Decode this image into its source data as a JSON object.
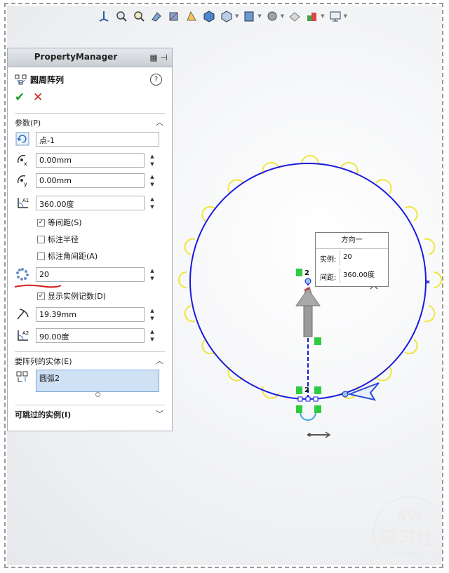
{
  "property_manager": {
    "title": "PropertyManager",
    "feature_name": "圆周阵列",
    "help_label": "?",
    "ok_glyph": "✔",
    "cancel_glyph": "✕",
    "params": {
      "header": "参数(P)",
      "center_point": "点-1",
      "center_x": "0.00mm",
      "center_y": "0.00mm",
      "angle": "360.00度",
      "equal_spacing_label": "等间距(S)",
      "equal_spacing_checked": true,
      "dim_radius_label": "标注半径",
      "dim_radius_checked": false,
      "dim_angle_label": "标注角间距(A)",
      "dim_angle_checked": false,
      "instances": "20",
      "show_count_label": "显示实例记数(D)",
      "show_count_checked": true,
      "radius": "19.39mm",
      "arc_angle": "90.00度"
    },
    "entities": {
      "header": "要阵列的实体(E)",
      "selected": "圆弧2"
    },
    "skip": {
      "header": "可跳过的实例(I)"
    }
  },
  "direction_popup": {
    "title": "方向一",
    "instances_label": "实例:",
    "instances_value": "20",
    "spacing_label": "间距:",
    "spacing_value": "360.00度"
  },
  "sketch": {
    "relation_label": "2",
    "circle_color": "#1a1adc",
    "pattern_arc_color": "#f0e63c",
    "relation_color": "#2ecc40"
  },
  "watermark": {
    "logo": "SW",
    "text": "研习社",
    "small": "SolidWorks"
  },
  "colors": {
    "accent": "#1d9b2a",
    "cancel": "#d01c1c",
    "selection": "#cfe1f5"
  }
}
